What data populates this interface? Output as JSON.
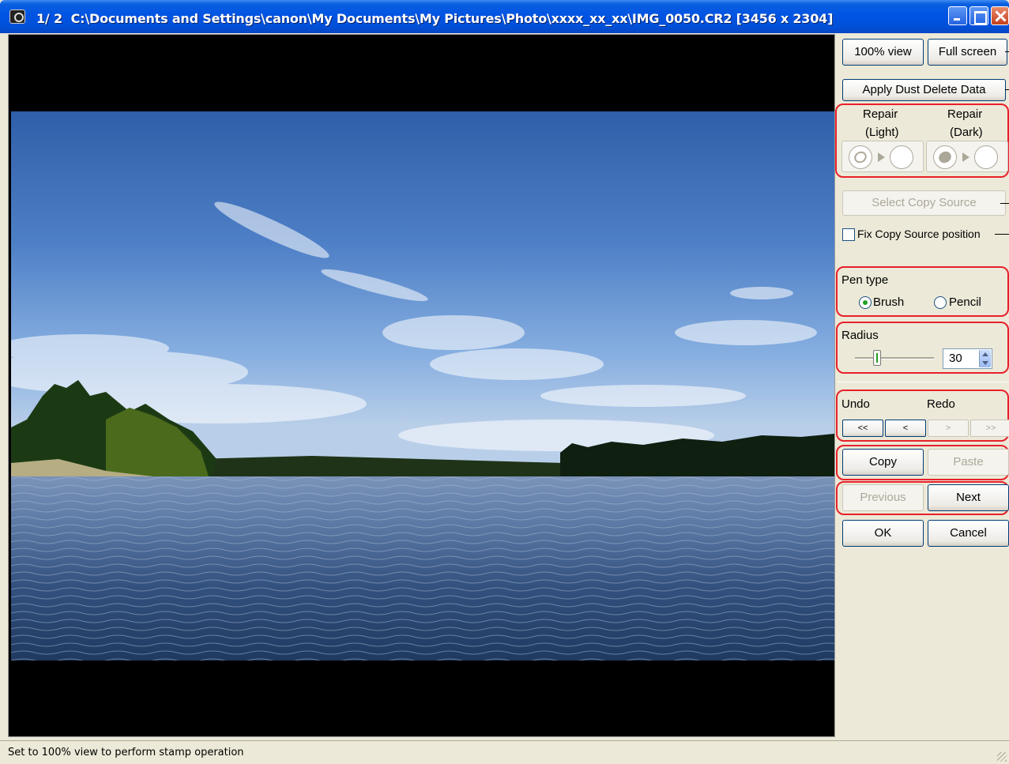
{
  "window": {
    "counter": "1/ 2",
    "path": "C:\\Documents and Settings\\canon\\My Documents\\My Pictures\\Photo\\xxxx_xx_xx\\IMG_0050.CR2 [3456 x 2304]"
  },
  "panel": {
    "view_100_label": "100% view",
    "fullscreen_label": "Full screen",
    "apply_dust_label": "Apply Dust Delete Data",
    "repair_light_line1": "Repair",
    "repair_light_line2": "(Light)",
    "repair_dark_line1": "Repair",
    "repair_dark_line2": "(Dark)",
    "select_copy_source_label": "Select Copy Source",
    "fix_copy_source_label": "Fix Copy Source position",
    "fix_copy_source_checked": false,
    "pen_type_label": "Pen type",
    "pen_brush_label": "Brush",
    "pen_pencil_label": "Pencil",
    "pen_selected": "Brush",
    "radius_label": "Radius",
    "radius_value": "30",
    "undo_label": "Undo",
    "redo_label": "Redo",
    "undo_all_label": "<<",
    "undo_one_label": "<",
    "redo_one_label": ">",
    "redo_all_label": ">>",
    "copy_label": "Copy",
    "paste_label": "Paste",
    "previous_label": "Previous",
    "next_label": "Next",
    "ok_label": "OK",
    "cancel_label": "Cancel"
  },
  "status": {
    "text": "Set to 100% view to perform stamp operation"
  },
  "colors": {
    "highlight": "#e8202a",
    "titlebar": "#0054e3",
    "window_bg": "#ece9d8"
  }
}
